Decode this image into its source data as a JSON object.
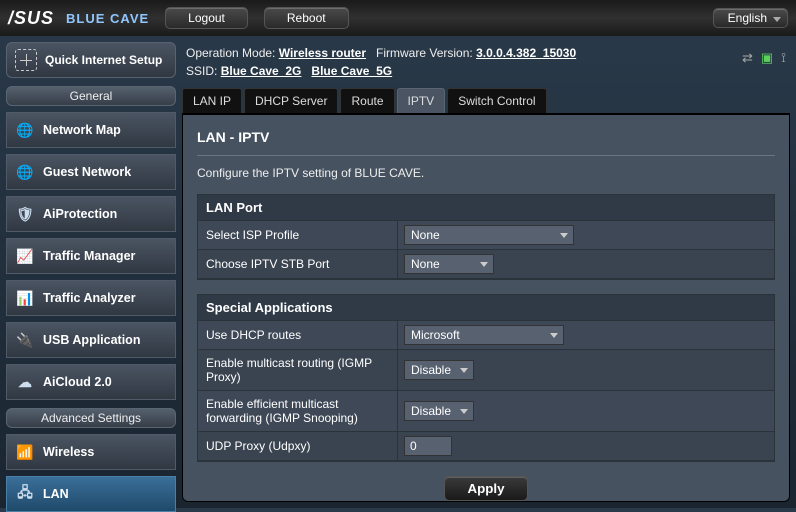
{
  "brand": "/SUS",
  "model": "BLUE CAVE",
  "topbar": {
    "logout": "Logout",
    "reboot": "Reboot",
    "language": "English"
  },
  "status": {
    "op_mode_label": "Operation Mode:",
    "op_mode_value": "Wireless router",
    "fw_label": "Firmware Version:",
    "fw_value": "3.0.0.4.382_15030",
    "ssid_label": "SSID:",
    "ssid1": "Blue Cave_2G",
    "ssid2": "Blue Cave_5G"
  },
  "sidebar": {
    "qis": "Quick Internet Setup",
    "general_header": "General",
    "advanced_header": "Advanced Settings",
    "general": [
      {
        "label": "Network Map",
        "icon": "🌐"
      },
      {
        "label": "Guest Network",
        "icon": "🌐"
      },
      {
        "label": "AiProtection",
        "icon": "🛡"
      },
      {
        "label": "Traffic Manager",
        "icon": "📈"
      },
      {
        "label": "Traffic Analyzer",
        "icon": "📊"
      },
      {
        "label": "USB Application",
        "icon": "🔌"
      },
      {
        "label": "AiCloud 2.0",
        "icon": "☁"
      }
    ],
    "advanced": [
      {
        "label": "Wireless",
        "icon": "📶"
      },
      {
        "label": "LAN",
        "icon": "🖧",
        "active": true
      }
    ]
  },
  "tabs": [
    "LAN IP",
    "DHCP Server",
    "Route",
    "IPTV",
    "Switch Control"
  ],
  "tabs_active": "IPTV",
  "page": {
    "title": "LAN - IPTV",
    "desc": "Configure the IPTV setting of BLUE CAVE."
  },
  "lanport": {
    "header": "LAN Port",
    "isp_profile_label": "Select ISP Profile",
    "isp_profile_value": "None",
    "stb_port_label": "Choose IPTV STB Port",
    "stb_port_value": "None"
  },
  "special": {
    "header": "Special Applications",
    "dhcp_routes_label": "Use DHCP routes",
    "dhcp_routes_value": "Microsoft",
    "igmp_proxy_label": "Enable multicast routing (IGMP Proxy)",
    "igmp_proxy_value": "Disable",
    "igmp_snoop_label": "Enable efficient multicast forwarding (IGMP Snooping)",
    "igmp_snoop_value": "Disable",
    "udp_proxy_label": "UDP Proxy (Udpxy)",
    "udp_proxy_value": "0"
  },
  "apply": "Apply"
}
